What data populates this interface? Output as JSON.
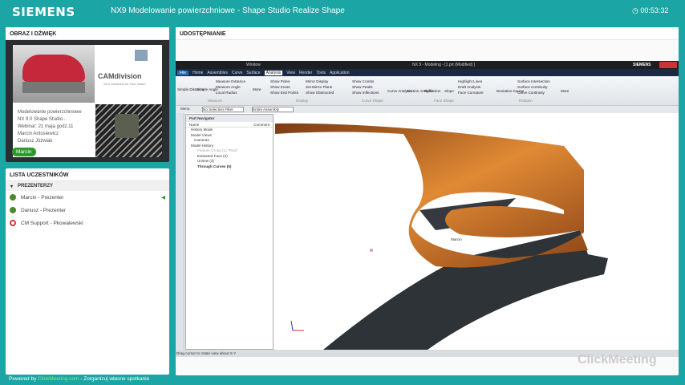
{
  "header": {
    "logo": "SIEMENS",
    "title": "NX9 Modelowanie powierzchniowe - Shape Studio Realize Shape",
    "timer": "00:53:32",
    "clock_icon": "clock-icon"
  },
  "video_panel": {
    "title": "OBRAZ I DŹWIĘK",
    "slide": {
      "brand": "CAMdivision",
      "tagline": "Your Solutions for Your Vision",
      "lines": [
        "Modelowanie powierzchniowe",
        "NX 9.0 Shape Studio...",
        "Webinar: 21 maja godz.11",
        "Marcin Antosiewicz",
        "Dariusz Jóźwiak"
      ]
    },
    "speaker_tag": "Marcin"
  },
  "participants": {
    "title": "LISTA UCZESTNIKÓW",
    "group": "PREZENTERZY",
    "items": [
      {
        "name": "Marcin - Prezenter",
        "icon": "user-icon",
        "speaking": true
      },
      {
        "name": "Dariusz - Prezenter",
        "icon": "user-icon"
      },
      {
        "name": "CM Support - Pkowalewski",
        "icon": "support-lifebuoy-icon"
      }
    ]
  },
  "share": {
    "title": "UDOSTĘPNIANIE",
    "nx": {
      "window_title": "NX 9 - Modeling - [1.prt (Modified) ]",
      "brand": "SIEMENS",
      "search_placeholder": "Find a Command",
      "quick_window": "Window",
      "tabs": [
        "File",
        "Home",
        "Assemblies",
        "Curve",
        "Surface",
        "Analysis",
        "View",
        "Render",
        "Tools",
        "Application"
      ],
      "active_tab": "Analysis",
      "ribbon": {
        "measure": [
          "Simple Distance",
          "Simple Angle",
          "Measure Distance",
          "Measure Angle",
          "Local Radius",
          "More"
        ],
        "display": [
          "Show Poles",
          "Show Knots",
          "Show End Points",
          "Mirror Display",
          "Set Mirror Plane",
          "Show Obstructed"
        ],
        "curve_shape": [
          "Show Combs",
          "Show Peaks",
          "Show Inflections",
          "Curve Analysis"
        ],
        "face_shape": [
          "Section Analysis",
          "Reflection",
          "Slope",
          "Highlight Lines",
          "Draft Analysis",
          "Face Curvature"
        ],
        "relation": [
          "Deviation Gauge",
          "Surface Intersection",
          "Surface Continuity",
          "Curve Continuity",
          "More"
        ],
        "groups": [
          "Measure",
          "Display",
          "Curve Shape",
          "Face Shape",
          "Relation"
        ]
      },
      "toolbar": {
        "menu": "Menu",
        "filter": "No Selection Filter",
        "scope": "Entire Assembly"
      },
      "navigator": {
        "title": "Part Navigator",
        "col_name": "Name",
        "col_comment": "Comment",
        "rows": [
          "History Mode",
          "Model Views",
          "Cameras",
          "Model History",
          "Feature Group (1) \"Real\"",
          "Extracted Face (2)",
          "Unsew (3)",
          "Through Curves (5)"
        ]
      },
      "cursor_label": "Marcin",
      "status": "Drag cursor to rotate view about X-Y"
    },
    "watermark": "ClickMeeting"
  },
  "footer": {
    "powered": "Powered by",
    "link": "ClickMeeting.com",
    "rest": "- Zorganizuj własne spotkanie"
  },
  "colors": {
    "background": "#1ba5a5",
    "surface_orange": "#d9772a",
    "surface_dark": "#2e3338",
    "speaker_green": "#2c9a2c"
  }
}
